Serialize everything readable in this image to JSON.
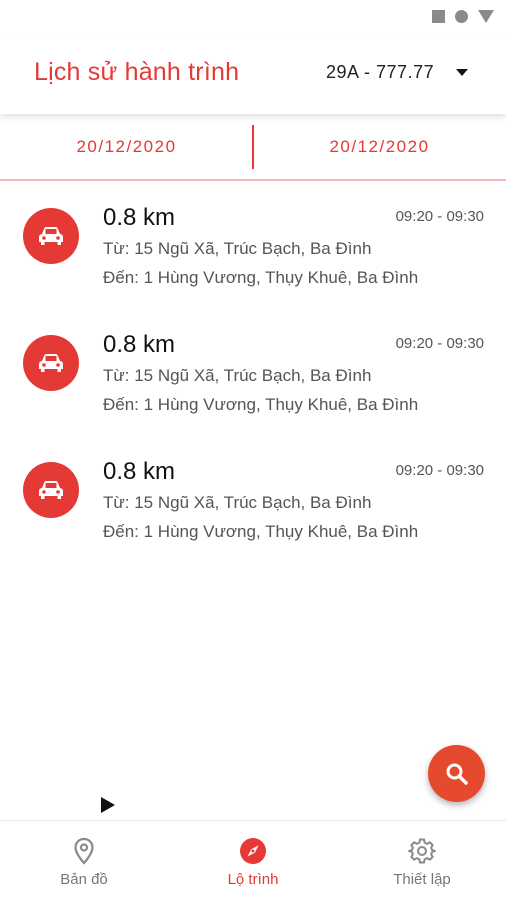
{
  "status_bar": {
    "icons": [
      "square-icon",
      "circle-icon",
      "triangle-icon"
    ]
  },
  "header": {
    "title": "Lịch sử hành trình",
    "vehicle": "29A - 777.77"
  },
  "date_range": {
    "from": "20/12/2020",
    "to": "20/12/2020"
  },
  "trips": [
    {
      "distance": "0.8 km",
      "time": "09:20 - 09:30",
      "from": "Từ: 15 Ngũ Xã, Trúc Bạch, Ba Đình",
      "to": "Đến: 1 Hùng Vương, Thụy Khuê, Ba Đình"
    },
    {
      "distance": "0.8 km",
      "time": "09:20 - 09:30",
      "from": "Từ: 15 Ngũ Xã, Trúc Bạch, Ba Đình",
      "to": "Đến: 1 Hùng Vương, Thụy Khuê, Ba Đình"
    },
    {
      "distance": "0.8 km",
      "time": "09:20 - 09:30",
      "from": "Từ: 15 Ngũ Xã, Trúc Bạch, Ba Đình",
      "to": "Đến: 1 Hùng Vương, Thụy Khuê, Ba Đình"
    }
  ],
  "nav": {
    "map_label": "Bản đồ",
    "route_label": "Lộ trình",
    "settings_label": "Thiết lập",
    "active": "route"
  },
  "colors": {
    "accent": "#e53935",
    "fab": "#e64a2e",
    "muted_text": "#555555"
  }
}
